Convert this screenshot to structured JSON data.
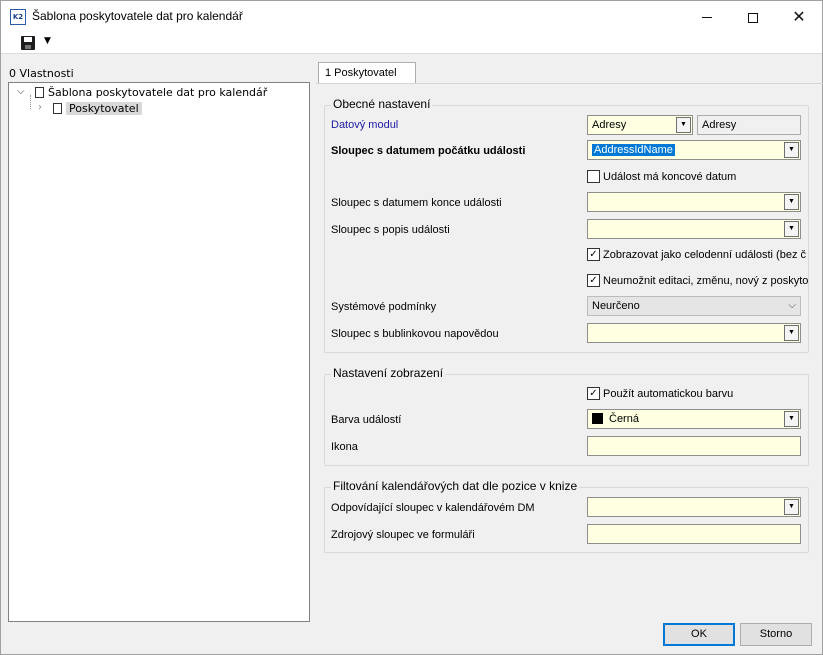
{
  "window": {
    "title": "Šablona poskytovatele dat pro kalendář",
    "icon_text": "K2"
  },
  "left_panel": {
    "label": "0 Vlastnosti",
    "tree": {
      "root_label": "Šablona poskytovatele dat pro kalendář",
      "child_label": "Poskytovatel"
    }
  },
  "tab": {
    "label": "1 Poskytovatel"
  },
  "general": {
    "title": "Obecné nastavení",
    "data_module_label": "Datový modul",
    "data_module_value": "Adresy",
    "data_module_name": "Adresy",
    "start_col_label": "Sloupec s datumem počátku události",
    "start_col_value": "AddressIdName",
    "has_end_label": "Událost má koncové datum",
    "end_col_label": "Sloupec s datumem konce události",
    "end_col_value": "",
    "desc_col_label": "Sloupec s popis události",
    "desc_col_value": "",
    "all_day_label": "Zobrazovat jako celodenní události (bez č",
    "no_edit_label": "Neumožnit editaci, změnu, nový z poskyto",
    "sys_cond_label": "Systémové podmínky",
    "sys_cond_value": "Neurčeno",
    "tooltip_col_label": "Sloupec s bublinkovou napovědou",
    "tooltip_col_value": ""
  },
  "display": {
    "title": "Nastavení zobrazení",
    "auto_color_label": "Použít automatickou barvu",
    "color_label": "Barva událostí",
    "color_value": "Černá",
    "icon_label": "Ikona",
    "icon_value": ""
  },
  "filter": {
    "title": "Filtování kalendářových dat dle pozice v knize",
    "cal_col_label": "Odpovídající sloupec v kalendářovém DM",
    "cal_col_value": "",
    "src_col_label": "Zdrojový sloupec ve formuláři",
    "src_col_value": ""
  },
  "buttons": {
    "ok": "OK",
    "cancel": "Storno"
  }
}
